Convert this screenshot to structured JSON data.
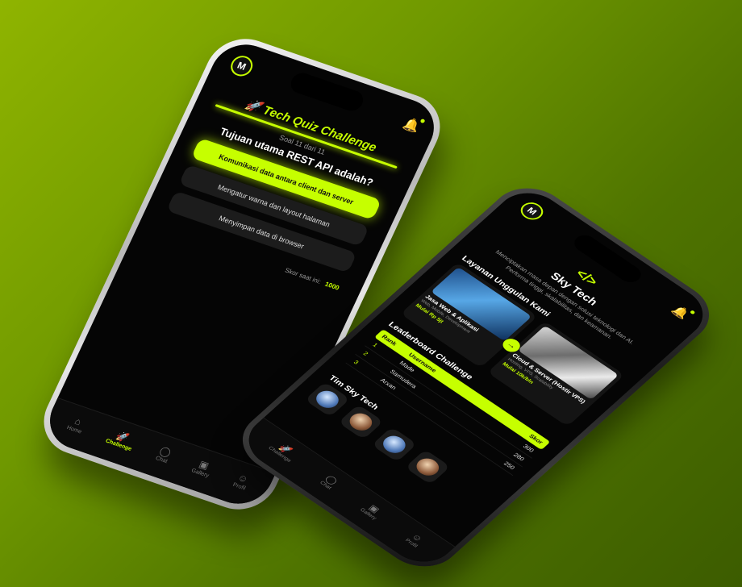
{
  "colors": {
    "accent": "#c6ff00",
    "screen_bg": "#050505",
    "backdrop": "#6f9800"
  },
  "phone1": {
    "avatar": "M",
    "bell_icon": "bell-icon",
    "quiz": {
      "title": "Tech Quiz Challenge",
      "title_icon": "rocket-icon",
      "progress": "Soal 11 dari 11",
      "question": "Tujuan utama REST API adalah?",
      "options": [
        "Komunikasi data antara client dan server",
        "Mengatur warna dan layout halaman",
        "Menyimpan data di browser"
      ],
      "selected_index": 0,
      "score_label": "Skor saat ini:",
      "score_value": "1000"
    },
    "nav": [
      {
        "label": "Home",
        "icon": "home-icon"
      },
      {
        "label": "Challenge",
        "icon": "rocket-icon"
      },
      {
        "label": "Chat",
        "icon": "chat-icon"
      },
      {
        "label": "Gallery",
        "icon": "gallery-icon"
      },
      {
        "label": "Profil",
        "icon": "profile-icon"
      }
    ],
    "active_nav": 1
  },
  "phone2": {
    "avatar": "M",
    "brand": {
      "icon": "code-icon",
      "name": "Sky Tech",
      "description": "Menciptakan masa depan dengan solusi teknologi dan AI. Performa tinggi, skalabilitas, dan keamanan."
    },
    "services_heading": "Layanan Unggulan Kami",
    "services": [
      {
        "title": "Jasa Web & Aplikasi",
        "subtitle": "Web, Mobile, Development",
        "price": "Mulai Rp 5jt"
      },
      {
        "title": "Cloud & Server (Hostir VPS)",
        "subtitle": "Hosting, VPS, Scalability",
        "price": "Mulai 10k/bln"
      }
    ],
    "leaderboard": {
      "heading": "Leaderboard Challenge",
      "columns": [
        "Rank",
        "Username",
        "Skor"
      ],
      "rows": [
        {
          "rank": "1",
          "username": "Made",
          "score": "300"
        },
        {
          "rank": "2",
          "username": "Samudera",
          "score": "280"
        },
        {
          "rank": "3",
          "username": "Arxan",
          "score": "250"
        }
      ]
    },
    "team_heading": "Tim Sky Tech",
    "nav": [
      {
        "label": "Challenge",
        "icon": "rocket-icon"
      },
      {
        "label": "Chat",
        "icon": "chat-icon"
      },
      {
        "label": "Gallery",
        "icon": "gallery-icon"
      },
      {
        "label": "Profil",
        "icon": "profile-icon"
      }
    ]
  }
}
